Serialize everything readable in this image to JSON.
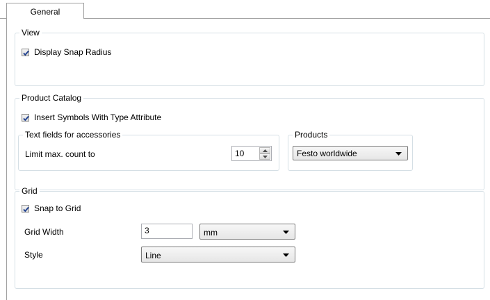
{
  "tabs": [
    {
      "label": "General"
    }
  ],
  "view": {
    "title": "View",
    "display_snap_radius": {
      "label": "Display Snap Radius",
      "checked": true
    }
  },
  "product_catalog": {
    "title": "Product Catalog",
    "insert_symbols": {
      "label": "Insert Symbols With Type Attribute",
      "checked": true
    },
    "text_fields": {
      "title": "Text fields for accessories",
      "limit_label": "Limit max. count to",
      "limit_value": "10"
    },
    "products": {
      "title": "Products",
      "selected": "Festo worldwide"
    }
  },
  "grid": {
    "title": "Grid",
    "snap_to_grid": {
      "label": "Snap to Grid",
      "checked": true
    },
    "width_label": "Grid Width",
    "width_value": "3",
    "unit_selected": "mm",
    "style_label": "Style",
    "style_selected": "Line"
  },
  "icons": {
    "checkmark": "check-icon",
    "dropdown": "chevron-down-icon",
    "spin_up": "spin-up-icon",
    "spin_down": "spin-down-icon"
  },
  "colors": {
    "checkmark": "#1b3d8f",
    "group_border": "#d5dfe5",
    "tab_border": "#a0a0a0"
  }
}
